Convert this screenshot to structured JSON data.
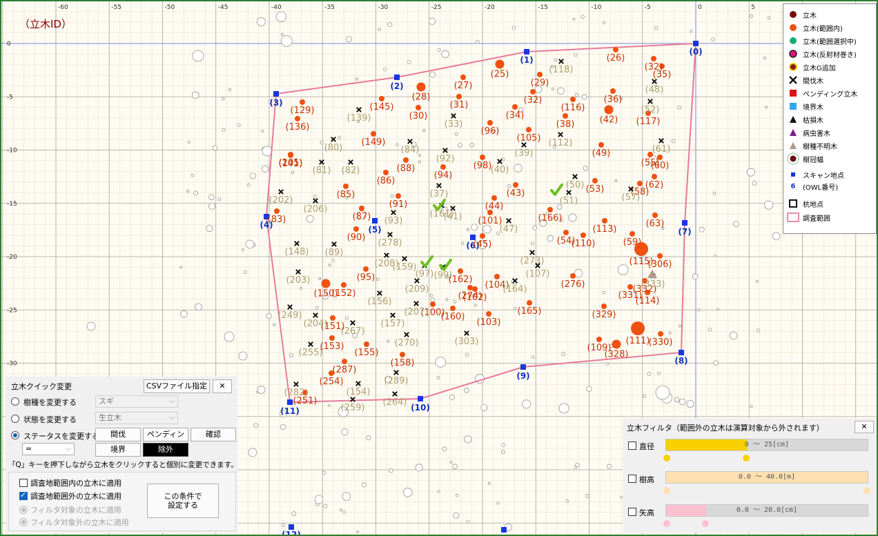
{
  "map": {
    "title": "（立木ID）",
    "x_ticks": [
      "-60",
      "-55",
      "-50",
      "-45",
      "-40",
      "-35",
      "-30",
      "-25",
      "-20",
      "-15",
      "-10",
      "-5",
      "0",
      "5"
    ],
    "y_ticks": [
      "0",
      "-5",
      "-10",
      "-15",
      "-20",
      "-25",
      "-30"
    ],
    "colors": {
      "tree_in": "#f05010",
      "tree_out_label": "#b0a070",
      "boundary": "#e87a9a",
      "point": "#1a35e0",
      "check": "#6cc020"
    },
    "survey_points": [
      {
        "label": "(0)"
      },
      {
        "label": "(1)"
      },
      {
        "label": "(2)"
      },
      {
        "label": "(3)"
      },
      {
        "label": "(4)"
      },
      {
        "label": "(5)"
      },
      {
        "label": "(6)"
      },
      {
        "label": "(7)"
      },
      {
        "label": "(8)"
      },
      {
        "label": "(9)"
      },
      {
        "label": "(10)"
      },
      {
        "label": "(11)"
      },
      {
        "label": "(12)"
      }
    ],
    "trees_in": [
      {
        "id": "(25)",
        "d": "m"
      },
      {
        "id": "(26)",
        "d": "s"
      },
      {
        "id": "(27)",
        "d": "s"
      },
      {
        "id": "(28)",
        "d": "m"
      },
      {
        "id": "(29)",
        "d": "s"
      },
      {
        "id": "(30)",
        "d": "s"
      },
      {
        "id": "(31)",
        "d": "s"
      },
      {
        "id": "(32)",
        "d": "s"
      },
      {
        "id": "(34)",
        "d": "s"
      },
      {
        "id": "(36)",
        "d": "s"
      },
      {
        "id": "(38)",
        "d": "s"
      },
      {
        "id": "(42)",
        "d": "m"
      },
      {
        "id": "(43)",
        "d": "s"
      },
      {
        "id": "(44)",
        "d": "s"
      },
      {
        "id": "(45)",
        "d": "s"
      },
      {
        "id": "(49)",
        "d": "s"
      },
      {
        "id": "(53)",
        "d": "s"
      },
      {
        "id": "(54)",
        "d": "s"
      },
      {
        "id": "(55)",
        "d": "s"
      },
      {
        "id": "(58)",
        "d": "s"
      },
      {
        "id": "(59)",
        "d": "s"
      },
      {
        "id": "(60)",
        "d": "s"
      },
      {
        "id": "(62)",
        "d": "s"
      },
      {
        "id": "(63)",
        "d": "s"
      },
      {
        "id": "(83)",
        "d": "s"
      },
      {
        "id": "(85)",
        "d": "s"
      },
      {
        "id": "(86)",
        "d": "s"
      },
      {
        "id": "(87)",
        "d": "s"
      },
      {
        "id": "(88)",
        "d": "s"
      },
      {
        "id": "(90)",
        "d": "s"
      },
      {
        "id": "(91)",
        "d": "s"
      },
      {
        "id": "(94)",
        "d": "s"
      },
      {
        "id": "(95)",
        "d": "s"
      },
      {
        "id": "(96)",
        "d": "s"
      },
      {
        "id": "(98)",
        "d": "s"
      },
      {
        "id": "(100)",
        "d": "s"
      },
      {
        "id": "(101)",
        "d": "s"
      },
      {
        "id": "(102)",
        "d": "s"
      },
      {
        "id": "(103)",
        "d": "s"
      },
      {
        "id": "(104)",
        "d": "s"
      },
      {
        "id": "(105)",
        "d": "s"
      },
      {
        "id": "(109)",
        "d": "s"
      },
      {
        "id": "(110)",
        "d": "s"
      },
      {
        "id": "(111)",
        "d": "l"
      },
      {
        "id": "(113)",
        "d": "s"
      },
      {
        "id": "(114)",
        "d": "s"
      },
      {
        "id": "(115)",
        "d": "l"
      },
      {
        "id": "(116)",
        "d": "s"
      },
      {
        "id": "(117)",
        "d": "s"
      },
      {
        "id": "(129)",
        "d": "s"
      },
      {
        "id": "(136)",
        "d": "s"
      },
      {
        "id": "(141)",
        "d": "s"
      },
      {
        "id": "(145)",
        "d": "s"
      },
      {
        "id": "(149)",
        "d": "s"
      },
      {
        "id": "(150)",
        "d": "m"
      },
      {
        "id": "(151)",
        "d": "s"
      },
      {
        "id": "(152)",
        "d": "s"
      },
      {
        "id": "(153)",
        "d": "s"
      },
      {
        "id": "(155)",
        "d": "s"
      },
      {
        "id": "(158)",
        "d": "s"
      },
      {
        "id": "(160)",
        "d": "s"
      },
      {
        "id": "(162)",
        "d": "s"
      },
      {
        "id": "(165)",
        "d": "s"
      },
      {
        "id": "(166)",
        "d": "s"
      },
      {
        "id": "(205)",
        "d": "s"
      },
      {
        "id": "(251)",
        "d": "s"
      },
      {
        "id": "(254)",
        "d": "s"
      },
      {
        "id": "(274)",
        "d": "s"
      },
      {
        "id": "(276)",
        "d": "s"
      },
      {
        "id": "(287)",
        "d": "s"
      },
      {
        "id": "(306)",
        "d": "s"
      },
      {
        "id": "(328)",
        "d": "m"
      },
      {
        "id": "(329)",
        "d": "s"
      },
      {
        "id": "(330)",
        "d": "s"
      },
      {
        "id": "(331)",
        "d": "s"
      },
      {
        "id": "(332)",
        "d": "s"
      },
      {
        "id": "(35)",
        "d": "s"
      },
      {
        "id": "(32)",
        "d": "s"
      }
    ],
    "trees_cut": [
      {
        "id": "(118)"
      },
      {
        "id": "(139)"
      },
      {
        "id": "(33)"
      },
      {
        "id": "(112)"
      },
      {
        "id": "(39)"
      },
      {
        "id": "(80)"
      },
      {
        "id": "(81)"
      },
      {
        "id": "(82)"
      },
      {
        "id": "(84)"
      },
      {
        "id": "(92)"
      },
      {
        "id": "(40)"
      },
      {
        "id": "(202)"
      },
      {
        "id": "(206)"
      },
      {
        "id": "(37)"
      },
      {
        "id": "(93)"
      },
      {
        "id": "(278)"
      },
      {
        "id": "(41)"
      },
      {
        "id": "(47)"
      },
      {
        "id": "(148)"
      },
      {
        "id": "(89)"
      },
      {
        "id": "(203)"
      },
      {
        "id": "(208)"
      },
      {
        "id": "(159)"
      },
      {
        "id": "(209)"
      },
      {
        "id": "(156)"
      },
      {
        "id": "(273)"
      },
      {
        "id": "(107)"
      },
      {
        "id": "(164)"
      },
      {
        "id": "(249)"
      },
      {
        "id": "(204)"
      },
      {
        "id": "(267)"
      },
      {
        "id": "(157)"
      },
      {
        "id": "(207)"
      },
      {
        "id": "(303)"
      },
      {
        "id": "(270)"
      },
      {
        "id": "(255)"
      },
      {
        "id": "(289)"
      },
      {
        "id": "(154)"
      },
      {
        "id": "(282)"
      },
      {
        "id": "(259)"
      },
      {
        "id": "(264)"
      },
      {
        "id": "(50)"
      },
      {
        "id": "(51)"
      },
      {
        "id": "(57)"
      },
      {
        "id": "(61)"
      },
      {
        "id": "(52)"
      },
      {
        "id": "(48)"
      },
      {
        "id": "(161)"
      },
      {
        "id": "(97)"
      },
      {
        "id": "(99)"
      },
      {
        "id": "(333)"
      }
    ]
  },
  "legend": {
    "items": [
      {
        "label": "立木",
        "icon": "dot-darkred"
      },
      {
        "label": "立木(範囲内)",
        "icon": "dot-orange"
      },
      {
        "label": "立木(範囲選択中)",
        "icon": "dot-green"
      },
      {
        "label": "立木(反射材巻き)",
        "icon": "dot-magenta"
      },
      {
        "label": "立木G追加",
        "icon": "dot-yellow"
      },
      {
        "label": "間伐木",
        "icon": "cross"
      },
      {
        "label": "ペンディング立木",
        "icon": "square-red"
      },
      {
        "label": "境界木",
        "icon": "square-cyan"
      },
      {
        "label": "枯損木",
        "icon": "triangle-black"
      },
      {
        "label": "病虫害木",
        "icon": "triangle-purple"
      },
      {
        "label": "樹種不明木",
        "icon": "triangle-tan"
      },
      {
        "label": "樹冠幅",
        "icon": "crown-ring"
      },
      {
        "label": "スキャン地点",
        "icon": "scan-point"
      },
      {
        "label": "(OWL番号)",
        "icon": ""
      },
      {
        "label": "杭地点",
        "icon": "stake"
      },
      {
        "label": "調査範囲",
        "icon": "survey-area"
      }
    ],
    "owl_prefix": "6"
  },
  "quick": {
    "title": "立木クイック変更",
    "csv_button": "CSVファイル指定",
    "close": "✕",
    "species_label": "樹種を変更する",
    "species_value": "スギ",
    "state_label": "状態を変更する",
    "state_value": "生立木",
    "status_label": "ステータスを変更する",
    "status_buttons": [
      "間伐",
      "ペンディング",
      "確認",
      "境界",
      "除外"
    ],
    "operator": "=",
    "hint": "「Q」キーを押下しながら立木をクリックすると個別に変更できます。",
    "apply_inside": "調査地範囲内の立木に適用",
    "apply_outside": "調査地範囲外の立木に適用",
    "apply_filtered": "フィルタ対象の立木に適用",
    "apply_unfiltered": "フィルタ対象外の立木に適用",
    "set_button": "この条件で\n設定する"
  },
  "filter": {
    "title": "立木フィルタ（範囲外の立木は演算対象から外されます）",
    "close": "✕",
    "diameter": {
      "label": "直径",
      "range": "0 〜 25[cm]",
      "fill_fraction": 0.4
    },
    "height": {
      "label": "樹高",
      "range": "0.0 〜 40.0[m]",
      "fill_fraction": 1.0
    },
    "arrow_height": {
      "label": "矢高",
      "range": "0.0 〜 20.0[cm]",
      "fill_fraction": 0.2
    }
  }
}
